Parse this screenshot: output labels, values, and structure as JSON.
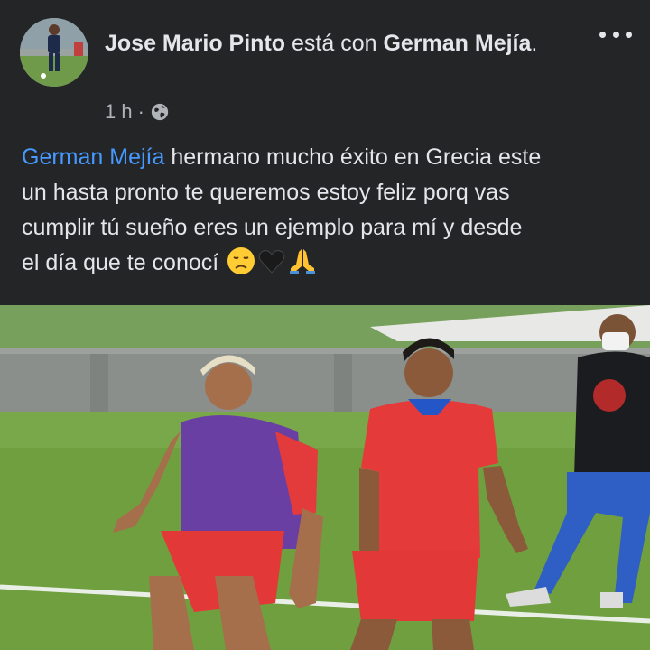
{
  "post": {
    "author": "Jose Mario Pinto",
    "connector": " está con ",
    "tagged": "German Mejía",
    "tagged_suffix": ".",
    "time": "1 h",
    "separator": "·",
    "audience_icon": "globe-icon",
    "more_icon": "more-options-icon",
    "body": {
      "mention": "German Mejía",
      "text_line1": " hermano mucho éxito en Grecia este",
      "text_line2": "un hasta pronto te queremos estoy feliz porq vas",
      "text_line3": "cumplir tú sueño eres un ejemplo para mí y desde",
      "text_line4": "el día que te conocí ",
      "emojis": [
        "disappointed-face-emoji",
        "black-heart-emoji",
        "folded-hands-emoji"
      ]
    }
  },
  "colors": {
    "background": "#242526",
    "text": "#e4e6eb",
    "secondary_text": "#b0b3b8",
    "mention": "#4599ff"
  }
}
